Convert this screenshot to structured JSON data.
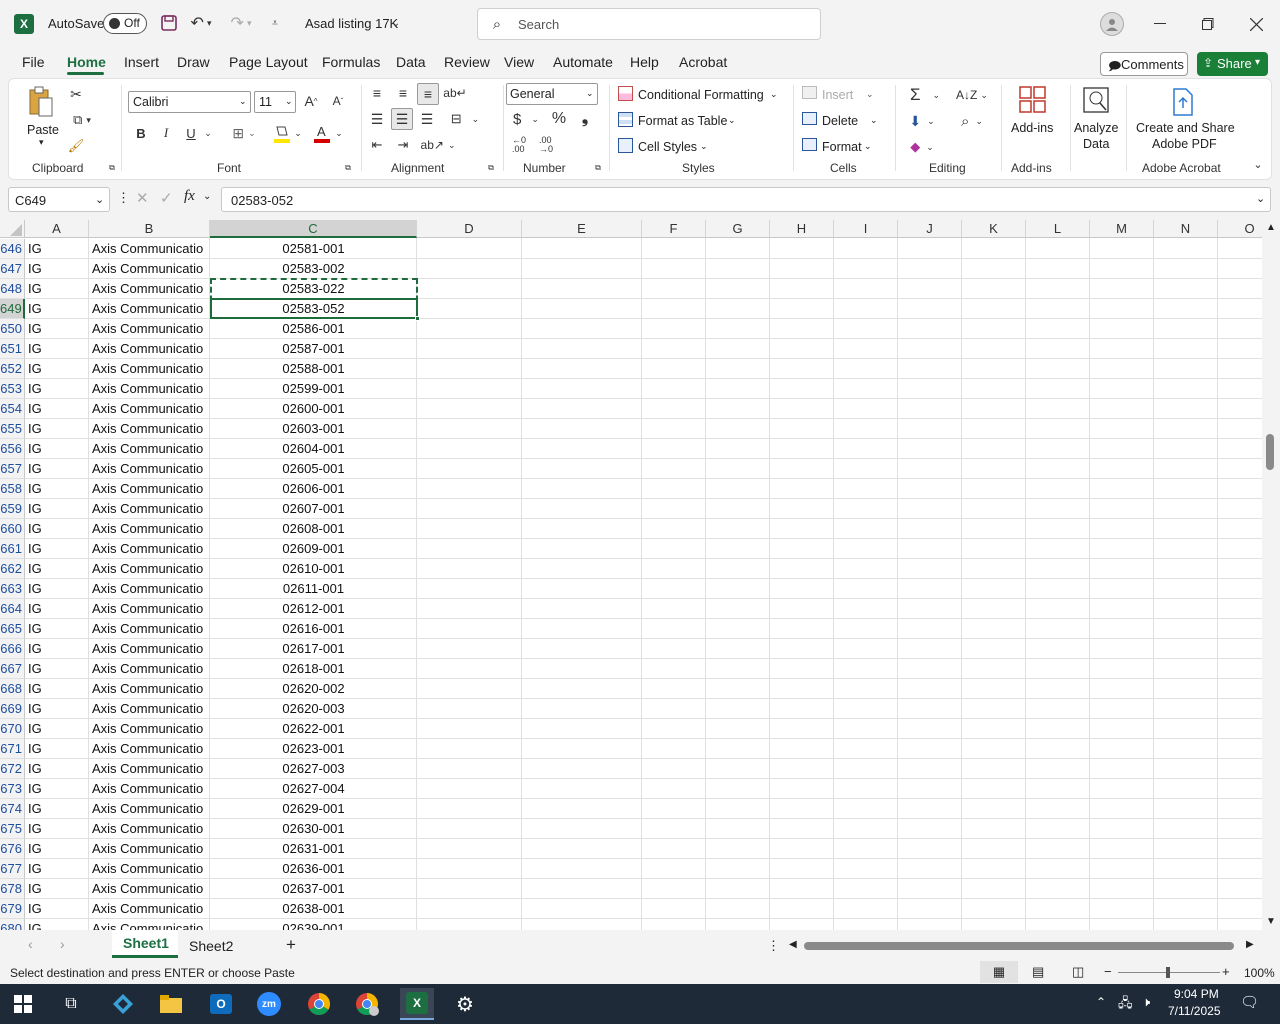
{
  "titlebar": {
    "autosave_label": "AutoSave",
    "autosave_state": "Off",
    "file_name": "Asad listing 17K",
    "search_placeholder": "Search"
  },
  "tabs": [
    "File",
    "Home",
    "Insert",
    "Draw",
    "Page Layout",
    "Formulas",
    "Data",
    "Review",
    "View",
    "Automate",
    "Help",
    "Acrobat"
  ],
  "active_tab": "Home",
  "actions": {
    "comments": "Comments",
    "share": "Share"
  },
  "ribbon": {
    "clipboard": {
      "paste": "Paste",
      "label": "Clipboard"
    },
    "font": {
      "name": "Calibri",
      "size": "11",
      "label": "Font",
      "bold": "B",
      "italic": "I",
      "underline": "U"
    },
    "alignment": {
      "label": "Alignment"
    },
    "number": {
      "format": "General",
      "label": "Number"
    },
    "styles": {
      "conditional": "Conditional Formatting",
      "table": "Format as Table",
      "cell": "Cell Styles",
      "label": "Styles"
    },
    "cells": {
      "insert": "Insert",
      "delete": "Delete",
      "format": "Format",
      "label": "Cells"
    },
    "editing": {
      "label": "Editing"
    },
    "addins": {
      "btn": "Add-ins",
      "label": "Add-ins"
    },
    "analyze": {
      "line1": "Analyze",
      "line2": "Data"
    },
    "acrobat": {
      "line1": "Create and Share",
      "line2": "Adobe PDF",
      "label": "Adobe Acrobat"
    }
  },
  "formula_bar": {
    "name_box": "C649",
    "fx": "fx",
    "value": "02583-052"
  },
  "columns": [
    "A",
    "B",
    "C",
    "D",
    "E",
    "F",
    "G",
    "H",
    "I",
    "J",
    "K",
    "L",
    "M",
    "N",
    "O"
  ],
  "rows": [
    {
      "n": "646",
      "a": "IG",
      "b": "Axis Communicatio",
      "c": "02581-001"
    },
    {
      "n": "647",
      "a": "IG",
      "b": "Axis Communicatio",
      "c": "02583-002"
    },
    {
      "n": "648",
      "a": "IG",
      "b": "Axis Communicatio",
      "c": "02583-022"
    },
    {
      "n": "649",
      "a": "IG",
      "b": "Axis Communicatio",
      "c": "02583-052"
    },
    {
      "n": "650",
      "a": "IG",
      "b": "Axis Communicatio",
      "c": "02586-001"
    },
    {
      "n": "651",
      "a": "IG",
      "b": "Axis Communicatio",
      "c": "02587-001"
    },
    {
      "n": "652",
      "a": "IG",
      "b": "Axis Communicatio",
      "c": "02588-001"
    },
    {
      "n": "653",
      "a": "IG",
      "b": "Axis Communicatio",
      "c": "02599-001"
    },
    {
      "n": "654",
      "a": "IG",
      "b": "Axis Communicatio",
      "c": "02600-001"
    },
    {
      "n": "655",
      "a": "IG",
      "b": "Axis Communicatio",
      "c": "02603-001"
    },
    {
      "n": "656",
      "a": "IG",
      "b": "Axis Communicatio",
      "c": "02604-001"
    },
    {
      "n": "657",
      "a": "IG",
      "b": "Axis Communicatio",
      "c": "02605-001"
    },
    {
      "n": "658",
      "a": "IG",
      "b": "Axis Communicatio",
      "c": "02606-001"
    },
    {
      "n": "659",
      "a": "IG",
      "b": "Axis Communicatio",
      "c": "02607-001"
    },
    {
      "n": "660",
      "a": "IG",
      "b": "Axis Communicatio",
      "c": "02608-001"
    },
    {
      "n": "661",
      "a": "IG",
      "b": "Axis Communicatio",
      "c": "02609-001"
    },
    {
      "n": "662",
      "a": "IG",
      "b": "Axis Communicatio",
      "c": "02610-001"
    },
    {
      "n": "663",
      "a": "IG",
      "b": "Axis Communicatio",
      "c": "02611-001"
    },
    {
      "n": "664",
      "a": "IG",
      "b": "Axis Communicatio",
      "c": "02612-001"
    },
    {
      "n": "665",
      "a": "IG",
      "b": "Axis Communicatio",
      "c": "02616-001"
    },
    {
      "n": "666",
      "a": "IG",
      "b": "Axis Communicatio",
      "c": "02617-001"
    },
    {
      "n": "667",
      "a": "IG",
      "b": "Axis Communicatio",
      "c": "02618-001"
    },
    {
      "n": "668",
      "a": "IG",
      "b": "Axis Communicatio",
      "c": "02620-002"
    },
    {
      "n": "669",
      "a": "IG",
      "b": "Axis Communicatio",
      "c": "02620-003"
    },
    {
      "n": "670",
      "a": "IG",
      "b": "Axis Communicatio",
      "c": "02622-001"
    },
    {
      "n": "671",
      "a": "IG",
      "b": "Axis Communicatio",
      "c": "02623-001"
    },
    {
      "n": "672",
      "a": "IG",
      "b": "Axis Communicatio",
      "c": "02627-003"
    },
    {
      "n": "673",
      "a": "IG",
      "b": "Axis Communicatio",
      "c": "02627-004"
    },
    {
      "n": "674",
      "a": "IG",
      "b": "Axis Communicatio",
      "c": "02629-001"
    },
    {
      "n": "675",
      "a": "IG",
      "b": "Axis Communicatio",
      "c": "02630-001"
    },
    {
      "n": "676",
      "a": "IG",
      "b": "Axis Communicatio",
      "c": "02631-001"
    },
    {
      "n": "677",
      "a": "IG",
      "b": "Axis Communicatio",
      "c": "02636-001"
    },
    {
      "n": "678",
      "a": "IG",
      "b": "Axis Communicatio",
      "c": "02637-001"
    },
    {
      "n": "679",
      "a": "IG",
      "b": "Axis Communicatio",
      "c": "02638-001"
    },
    {
      "n": "680",
      "a": "IG",
      "b": "Axis Communicatio",
      "c": "02639-001"
    }
  ],
  "sheets": [
    "Sheet1",
    "Sheet2"
  ],
  "active_sheet": "Sheet1",
  "status": {
    "message": "Select destination and press ENTER or choose Paste",
    "zoom": "100%"
  },
  "clock": {
    "time": "9:04 PM",
    "date": "7/11/2025"
  },
  "colors": {
    "accent": "#217346",
    "selection": "#1e6b3c",
    "share_bg": "#1a7f37",
    "rownum": "#1e4e9e"
  }
}
